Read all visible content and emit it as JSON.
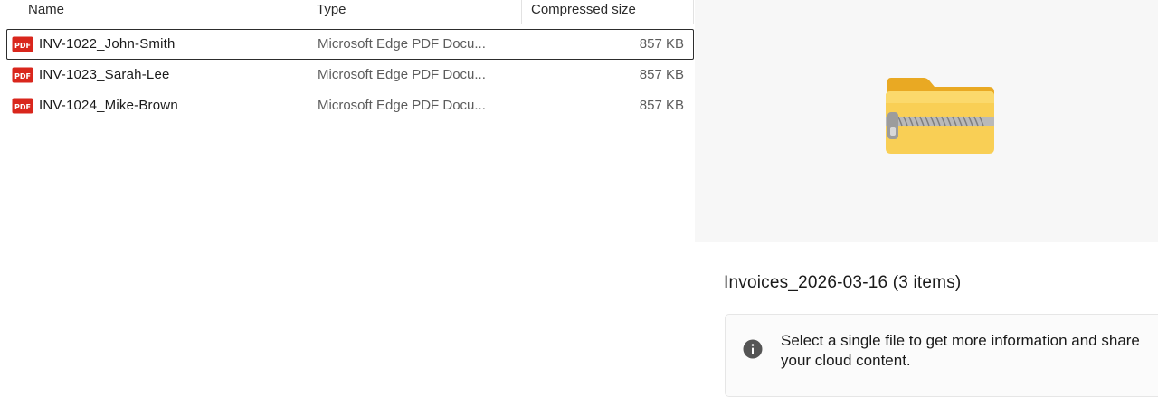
{
  "columns": {
    "name": "Name",
    "type": "Type",
    "compressed_size": "Compressed size"
  },
  "files": [
    {
      "name": "INV-1022_John-Smith",
      "type": "Microsoft Edge PDF Docu...",
      "size": "857 KB",
      "icon": "pdf-icon"
    },
    {
      "name": "INV-1023_Sarah-Lee",
      "type": "Microsoft Edge PDF Docu...",
      "size": "857 KB",
      "icon": "pdf-icon"
    },
    {
      "name": "INV-1024_Mike-Brown",
      "type": "Microsoft Edge PDF Docu...",
      "size": "857 KB",
      "icon": "pdf-icon"
    }
  ],
  "details": {
    "preview_icon": "zipped-folder-icon",
    "title": "Invoices_2026-03-16 (3 items)",
    "info_icon": "info-icon",
    "info_message": "Select a single file to get more information and share your cloud content."
  },
  "colors": {
    "pdf_red": "#d9261c",
    "folder_yellow": "#f7c948",
    "selection_border": "#2d2d2d"
  }
}
